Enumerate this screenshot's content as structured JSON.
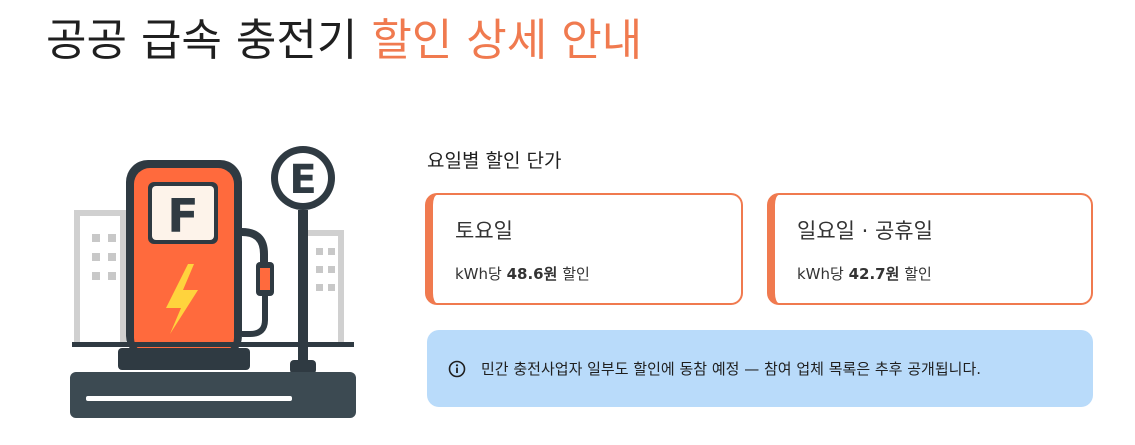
{
  "header": {
    "title_main": "공공 급속 충전기",
    "title_accent": "할인 상세 안내"
  },
  "illustration": {
    "pump_letter": "F",
    "sign_letter": "E",
    "colors": {
      "pump": "#ff6a3d",
      "dark": "#2f3a42",
      "bolt": "#ffd33d",
      "building": "#c8c8c8"
    }
  },
  "section": {
    "label": "요일별 할인 단가"
  },
  "cards": [
    {
      "title": "토요일",
      "prefix": "kWh당",
      "amount": "48.6원",
      "suffix": "할인"
    },
    {
      "title": "일요일 · 공휴일",
      "prefix": "kWh당",
      "amount": "42.7원",
      "suffix": "할인"
    }
  ],
  "notice": {
    "icon": "info-icon",
    "text": "민간 충전사업자 일부도 할인에 동참 예정 — 참여 업체 목록은 추후 공개됩니다."
  },
  "colors": {
    "accent": "#f07a4f",
    "notice_bg": "#b9dbfa"
  }
}
